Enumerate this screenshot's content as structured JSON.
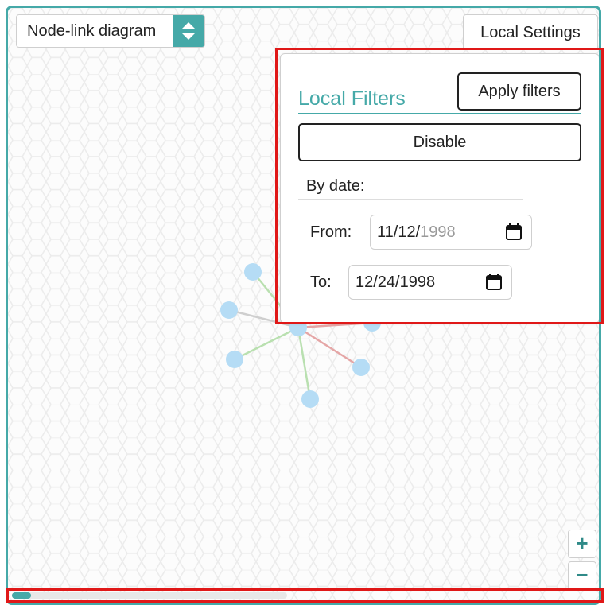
{
  "view_selector": {
    "selected": "Node-link diagram"
  },
  "local_settings": {
    "label": "Local Settings"
  },
  "filters_panel": {
    "title": "Local Filters",
    "apply_label": "Apply filters",
    "disable_label": "Disable",
    "by_date_label": "By date:",
    "from_label": "From:",
    "from_value_main": "11/12/",
    "from_value_dim": "1998",
    "to_label": "To:",
    "to_value": "12/24/1998"
  },
  "zoom": {
    "in_label": "+",
    "out_label": "−"
  },
  "colors": {
    "accent": "#45a9a8",
    "node": "#b5dcf5",
    "edge_green": "#b9e0b0",
    "edge_red": "#e5a6a6",
    "edge_gray": "#cfcfcf",
    "highlight": "#e01818"
  },
  "icons": [
    "up-down-chevron-icon",
    "calendar-icon",
    "plus-icon",
    "minus-icon"
  ]
}
